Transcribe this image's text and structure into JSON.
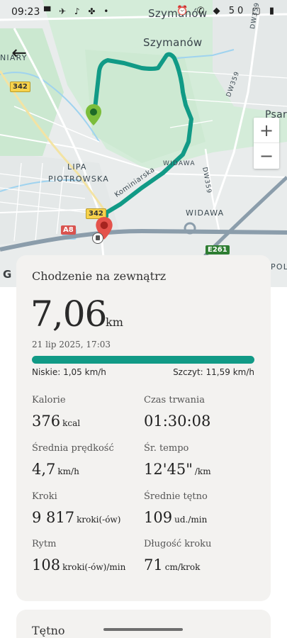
{
  "status_bar": {
    "time": "09:23",
    "icons": "▀ ✈ ♪ ✤ •",
    "right_icons": "⏰ ✆ ◆ 50 ▢ ▮"
  },
  "map": {
    "labels": {
      "szymanow_top": "Szymanów",
      "szymanow": "Szymanów",
      "niary": "NIARY",
      "psar": "Psar",
      "lipa": "LIPA",
      "piotrowska": "PIOTROWSKA",
      "widawa_small": "WIDAWA",
      "widawa": "WIDAWA",
      "kominiarska": "Kominiarska",
      "dw359_a": "DW359",
      "dw359_b": "DW359",
      "dw359_c": "DW359",
      "pol": "POL",
      "badge_342_a": "342",
      "badge_342_b": "342",
      "badge_a8": "A8",
      "badge_e261": "E261"
    },
    "zoom_in": "+",
    "zoom_out": "−",
    "back_icon": "←",
    "logo": "G",
    "route_color": "#119a86"
  },
  "activity": {
    "title": "Chodzenie na zewnątrz",
    "distance": "7,06",
    "distance_unit": "km",
    "date": "21 lip 2025, 17:03",
    "speed_low": "Niskie:  1,05 km/h",
    "speed_high": "Szczyt:  11,59 km/h",
    "accent_color": "#119a86",
    "stats": [
      {
        "label": "Kalorie",
        "value": "376",
        "unit": "kcal"
      },
      {
        "label": "Czas trwania",
        "value": "01:30:08",
        "unit": ""
      },
      {
        "label": "Średnia prędkość",
        "value": "4,7",
        "unit": "km/h"
      },
      {
        "label": "Śr. tempo",
        "value": "12'45\"",
        "unit": "/km"
      },
      {
        "label": "Kroki",
        "value": "9 817",
        "unit": "kroki(-ów)"
      },
      {
        "label": "Średnie tętno",
        "value": "109",
        "unit": "ud./min"
      },
      {
        "label": "Rytm",
        "value": "108",
        "unit": "kroki(-ów)/min"
      },
      {
        "label": "Długość kroku",
        "value": "71",
        "unit": "cm/krok"
      }
    ]
  },
  "heart_rate": {
    "title": "Tętno"
  }
}
